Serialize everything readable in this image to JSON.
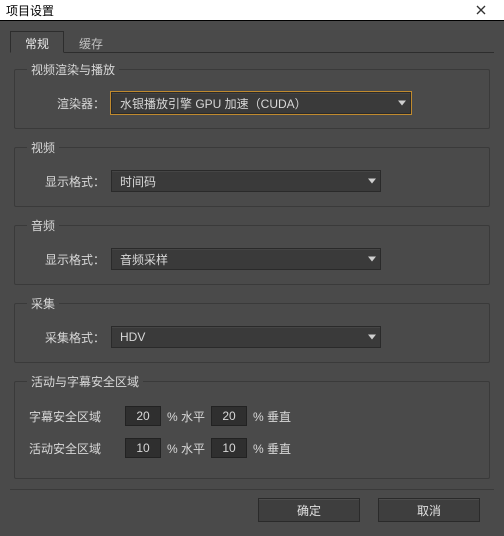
{
  "window": {
    "title": "项目设置"
  },
  "tabs": {
    "general": "常规",
    "cache": "缓存"
  },
  "groups": {
    "render_playback": {
      "legend": "视频渲染与播放",
      "renderer_label": "渲染器：",
      "renderer_value": "水银播放引擎 GPU 加速（CUDA）"
    },
    "video": {
      "legend": "视频",
      "format_label": "显示格式：",
      "format_value": "时间码"
    },
    "audio": {
      "legend": "音频",
      "format_label": "显示格式：",
      "format_value": "音频采样"
    },
    "capture": {
      "legend": "采集",
      "format_label": "采集格式：",
      "format_value": "HDV"
    },
    "safe_areas": {
      "legend": "活动与字幕安全区域",
      "title_safe_label": "字幕安全区域",
      "action_safe_label": "活动安全区域",
      "title_h": "20",
      "title_v": "20",
      "action_h": "10",
      "action_v": "10",
      "pct_h": "% 水平",
      "pct_v": "% 垂直"
    }
  },
  "buttons": {
    "ok": "确定",
    "cancel": "取消"
  }
}
